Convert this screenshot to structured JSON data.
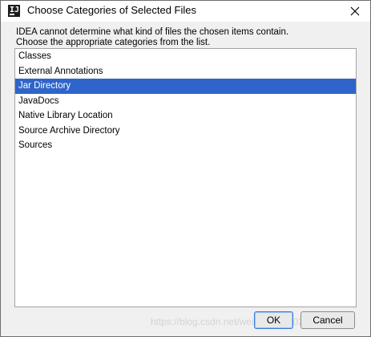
{
  "window": {
    "title": "Choose Categories of Selected Files",
    "app_icon": "intellij-idea-icon",
    "close_icon": "close-icon"
  },
  "message": {
    "line1": "IDEA cannot determine what kind of files the chosen items contain.",
    "line2": "Choose the appropriate categories from the list."
  },
  "list": {
    "selected_index": 2,
    "items": [
      {
        "label": "Classes"
      },
      {
        "label": "External Annotations"
      },
      {
        "label": "Jar Directory"
      },
      {
        "label": "JavaDocs"
      },
      {
        "label": "Native Library Location"
      },
      {
        "label": "Source Archive Directory"
      },
      {
        "label": "Sources"
      }
    ]
  },
  "buttons": {
    "ok_label": "OK",
    "cancel_label": "Cancel"
  },
  "watermark": {
    "text": "https://blog.csdn.net/weixin_39370254"
  },
  "colors": {
    "selection": "#2f65ca",
    "dialog_background": "#f0f0f0",
    "list_background": "#ffffff"
  }
}
